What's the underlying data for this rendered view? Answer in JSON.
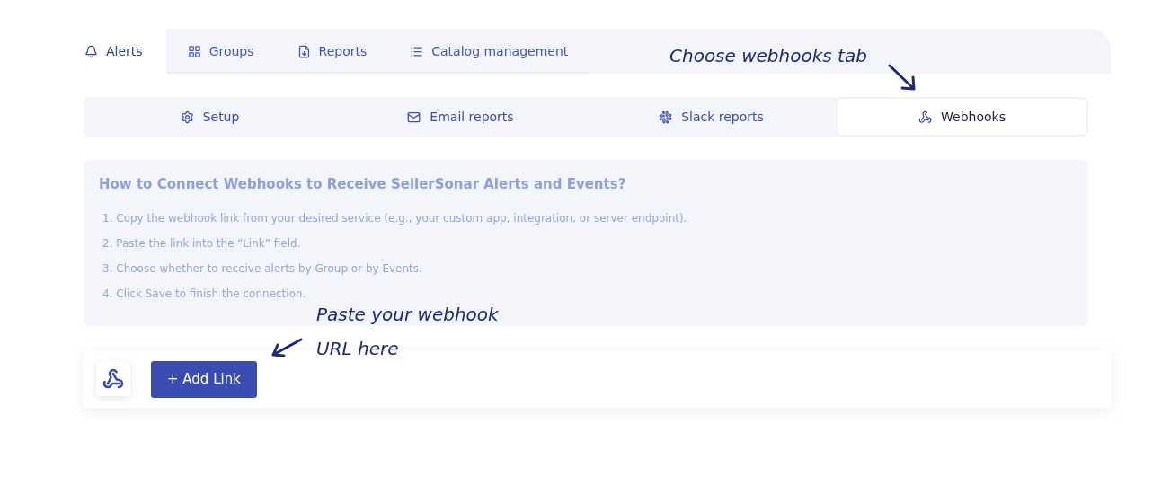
{
  "main_tabs": [
    {
      "label": "Alerts",
      "selected": true
    },
    {
      "label": "Groups",
      "selected": false
    },
    {
      "label": "Reports",
      "selected": false
    },
    {
      "label": "Catalog management",
      "selected": false
    }
  ],
  "sub_tabs": [
    {
      "label": "Setup",
      "selected": false
    },
    {
      "label": "Email reports",
      "selected": false
    },
    {
      "label": "Slack reports",
      "selected": false
    },
    {
      "label": "Webhooks",
      "selected": true
    }
  ],
  "info": {
    "title": "How to Connect Webhooks to Receive SellerSonar Alerts and Events?",
    "steps": [
      "1. Copy the webhook link from your desired service (e.g., your custom app, integration, or server endpoint).",
      "2. Paste the link into the “Link” field.",
      "3. Choose whether to receive alerts by Group or by Events.",
      "4. Click Save to finish the connection."
    ]
  },
  "add_link_button": "+ Add Link",
  "annotations": [
    {
      "kind": "tab",
      "lines": [
        "Choose webhooks tab"
      ]
    },
    {
      "kind": "field",
      "lines": [
        "Paste your webhook",
        "URL here"
      ]
    }
  ]
}
